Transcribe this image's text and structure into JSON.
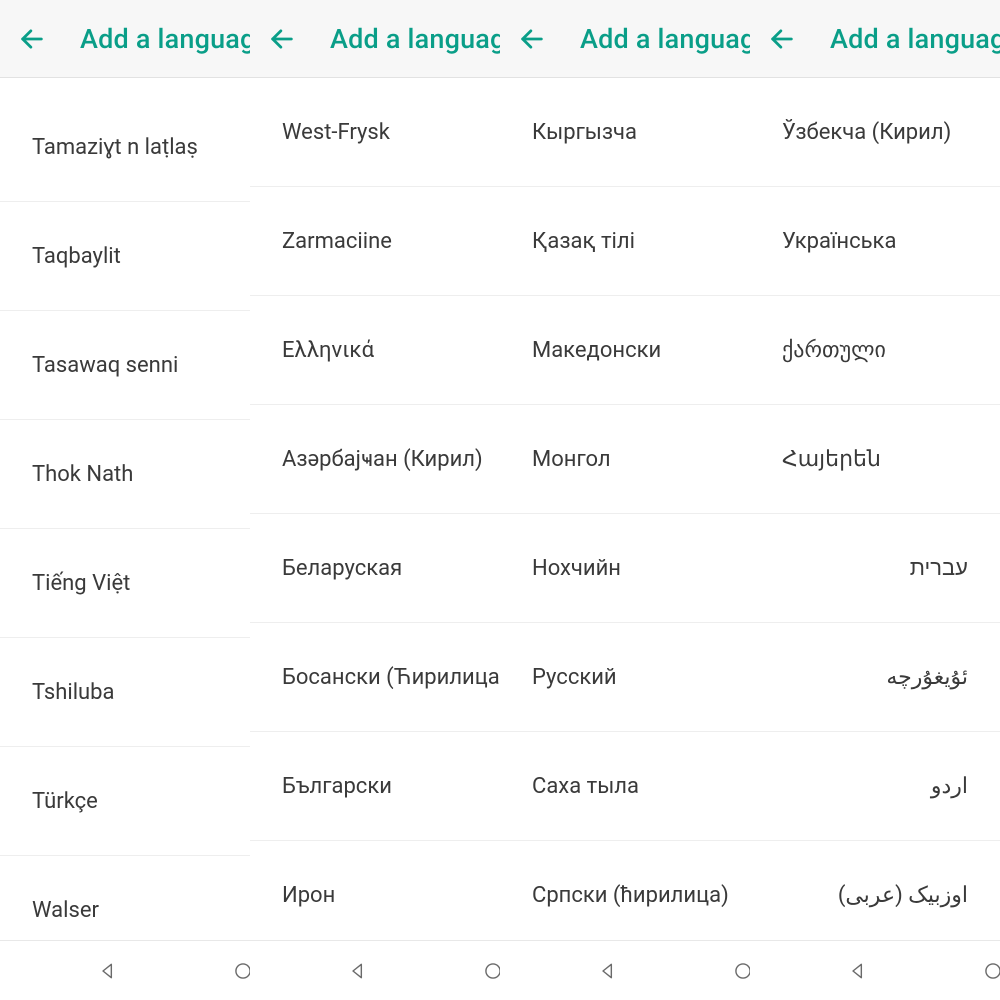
{
  "header": {
    "title": "Add a language"
  },
  "panels": [
    {
      "items": [
        {
          "label": "Tamaziɣt n laṭlaṣ"
        },
        {
          "label": "Taqbaylit"
        },
        {
          "label": "Tasawaq senni"
        },
        {
          "label": "Thok Nath"
        },
        {
          "label": "Tiếng Việt"
        },
        {
          "label": "Tshiluba"
        },
        {
          "label": "Türkçe"
        },
        {
          "label": "Walser"
        }
      ]
    },
    {
      "items": [
        {
          "label": "West-Frysk"
        },
        {
          "label": "Zarmaciine"
        },
        {
          "label": "Ελληνικά"
        },
        {
          "label": "Азәрбајҹан (Кирил)"
        },
        {
          "label": "Беларуская"
        },
        {
          "label": "Босански (Ћирилица)"
        },
        {
          "label": "Български"
        },
        {
          "label": "Ирон"
        }
      ]
    },
    {
      "items": [
        {
          "label": "Кыргызча"
        },
        {
          "label": "Қазақ тілі"
        },
        {
          "label": "Македонски"
        },
        {
          "label": "Монгол"
        },
        {
          "label": "Нохчийн"
        },
        {
          "label": "Русский"
        },
        {
          "label": "Саха тыла"
        },
        {
          "label": "Српски (ћирилица)"
        }
      ]
    },
    {
      "items": [
        {
          "label": "Ўзбекча (Кирил)"
        },
        {
          "label": "Українська"
        },
        {
          "label": "ქართული"
        },
        {
          "label": "Հայերեն"
        },
        {
          "label": "עברית",
          "rtl": true
        },
        {
          "label": "ئۇيغۇرچە",
          "rtl": true
        },
        {
          "label": "اردو",
          "rtl": true
        },
        {
          "label": "اوزبیک (عربی)",
          "rtl": true
        }
      ]
    }
  ]
}
